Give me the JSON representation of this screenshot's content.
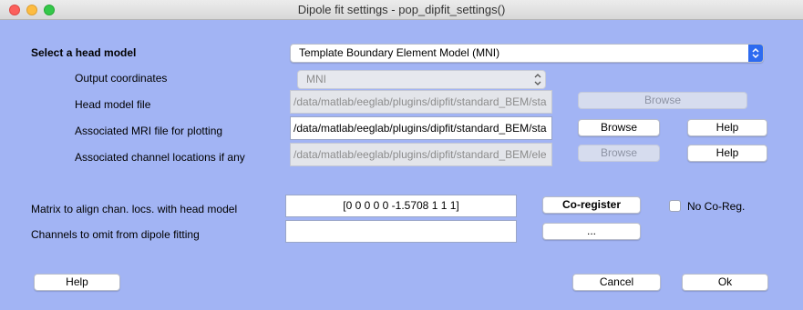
{
  "window": {
    "title": "Dipole fit settings - pop_dipfit_settings()"
  },
  "head_model": {
    "label": "Select a head model",
    "selected": "Template Boundary Element Model (MNI)"
  },
  "output_coords": {
    "label": "Output coordinates",
    "selected": "MNI"
  },
  "head_model_file": {
    "label": "Head model file",
    "value": "/data/matlab/eeglab/plugins/dipfit/standard_BEM/sta",
    "browse": "Browse"
  },
  "mri_file": {
    "label": "Associated MRI file for plotting",
    "value": "/data/matlab/eeglab/plugins/dipfit/standard_BEM/sta",
    "browse": "Browse",
    "help": "Help"
  },
  "chanlocs": {
    "label": "Associated channel locations if any",
    "value": "/data/matlab/eeglab/plugins/dipfit/standard_BEM/ele",
    "browse": "Browse",
    "help": "Help"
  },
  "align_matrix": {
    "label": "Matrix to align chan. locs. with head model",
    "value": "[0 0 0 0 0 -1.5708 1 1 1]",
    "coregister": "Co-register",
    "no_coreg": "No Co-Reg."
  },
  "omit_channels": {
    "label": "Channels to omit from dipole fitting",
    "value": "",
    "more": "..."
  },
  "footer": {
    "help": "Help",
    "cancel": "Cancel",
    "ok": "Ok"
  },
  "colors": {
    "background": "#a2b4f4",
    "accent": "#2d6bf0"
  }
}
